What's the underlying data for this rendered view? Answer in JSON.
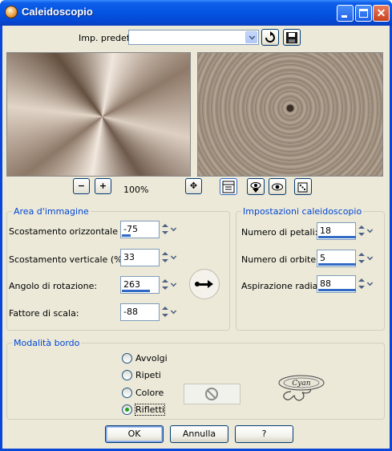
{
  "window": {
    "title": "Caleidoscopio",
    "controls": {
      "close_glyph": "✕"
    }
  },
  "preset": {
    "label": "Imp. predef.:",
    "value": ""
  },
  "zoom": {
    "level": "100%",
    "zoom_out_glyph": "−",
    "zoom_in_glyph": "+",
    "pan_glyph": "✥"
  },
  "area": {
    "title": "Area d'immagine",
    "fields": [
      {
        "label": "Scostamento orizzontale (%):",
        "value": "-75"
      },
      {
        "label": "Scostamento verticale (%):",
        "value": "33"
      },
      {
        "label": "Angolo di rotazione:",
        "value": "263"
      },
      {
        "label": "Fattore di scala:",
        "value": "-88"
      }
    ]
  },
  "settings": {
    "title": "Impostazioni caleidoscopio",
    "fields": [
      {
        "label": "Numero di petali:",
        "value": "18"
      },
      {
        "label": "Numero di orbite:",
        "value": "5"
      },
      {
        "label": "Aspirazione radiale:",
        "value": "88"
      }
    ]
  },
  "border_mode": {
    "title": "Modalità bordo",
    "options": [
      {
        "label": "Avvolgi",
        "checked": false
      },
      {
        "label": "Ripeti",
        "checked": false
      },
      {
        "label": "Colore",
        "checked": false
      },
      {
        "label": "Rifletti",
        "checked": true
      }
    ],
    "logo_text": "Cyan"
  },
  "buttons": {
    "ok": "OK",
    "cancel": "Annulla",
    "help": "?"
  },
  "colors": {
    "title_bar": "#0454e3",
    "group_title": "#0046d5",
    "dialog_bg": "#ece9d8",
    "slider_bar": "#316ac5"
  }
}
